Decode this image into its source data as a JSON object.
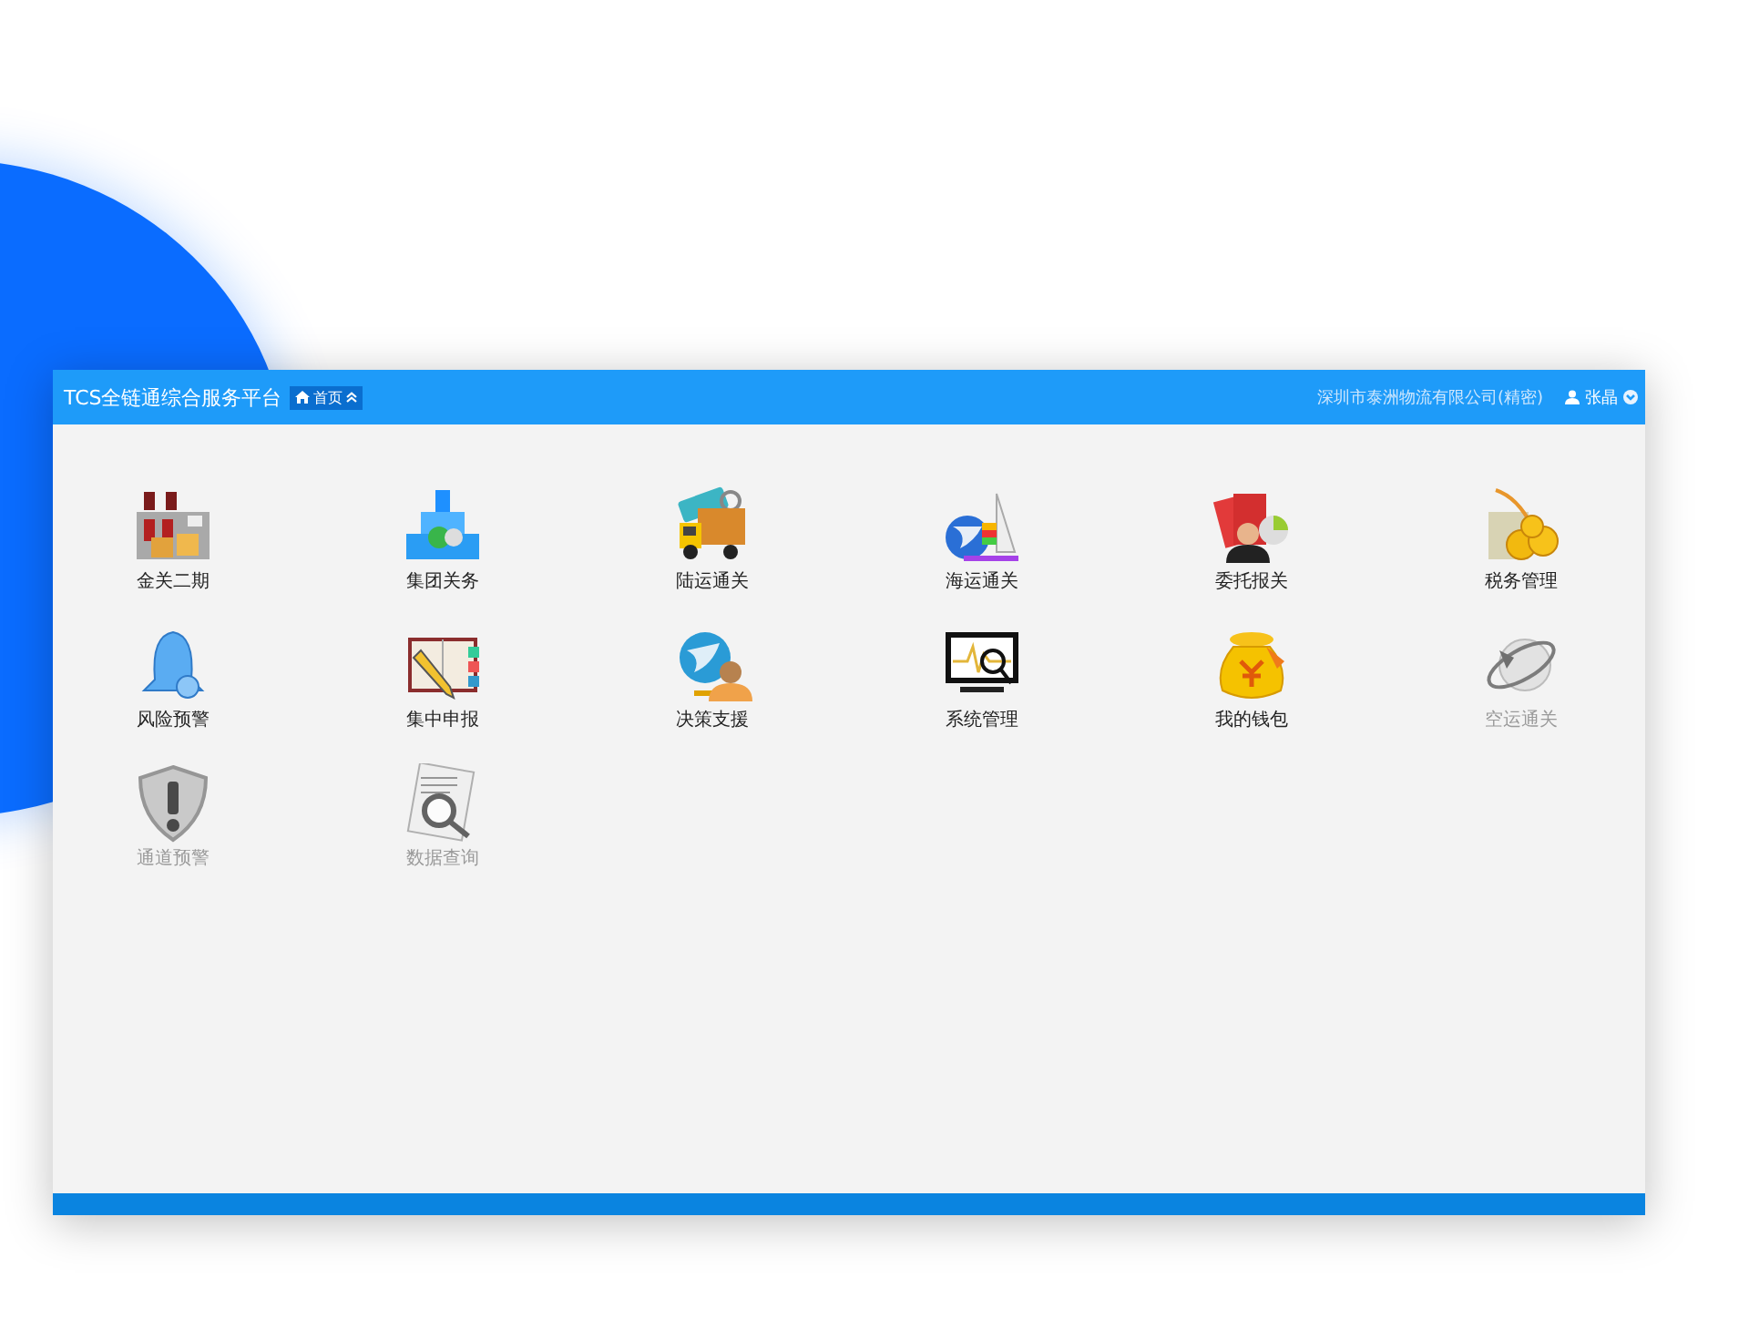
{
  "header": {
    "title": "TCS全链通综合服务平台",
    "home_button": "首页",
    "company": "深圳市泰洲物流有限公司(精密)",
    "user": "张晶"
  },
  "tiles": [
    {
      "label": "金关二期",
      "disabled": false
    },
    {
      "label": "集团关务",
      "disabled": false
    },
    {
      "label": "陆运通关",
      "disabled": false
    },
    {
      "label": "海运通关",
      "disabled": false
    },
    {
      "label": "委托报关",
      "disabled": false
    },
    {
      "label": "税务管理",
      "disabled": false
    },
    {
      "label": "风险预警",
      "disabled": false
    },
    {
      "label": "集中申报",
      "disabled": false
    },
    {
      "label": "决策支援",
      "disabled": false
    },
    {
      "label": "系统管理",
      "disabled": false
    },
    {
      "label": "我的钱包",
      "disabled": false
    },
    {
      "label": "空运通关",
      "disabled": true
    },
    {
      "label": "通道预警",
      "disabled": true
    },
    {
      "label": "数据查询",
      "disabled": true
    }
  ]
}
